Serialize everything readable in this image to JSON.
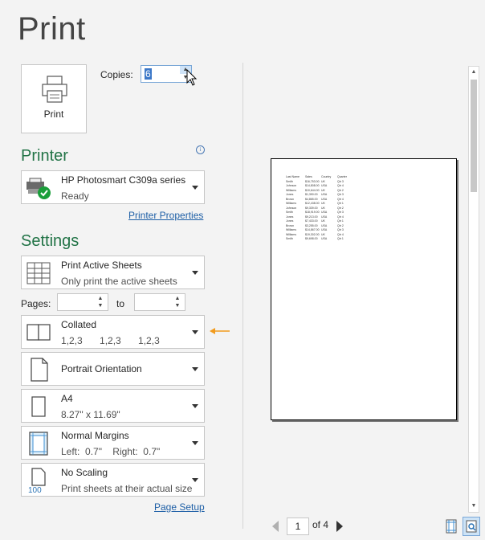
{
  "title": "Print",
  "print_button": {
    "label": "Print"
  },
  "copies": {
    "label": "Copies:",
    "value": "6"
  },
  "printer": {
    "section_title": "Printer",
    "name": "HP Photosmart C309a series",
    "status": "Ready",
    "properties_link": "Printer Properties"
  },
  "settings": {
    "section_title": "Settings",
    "sheets": {
      "title": "Print Active Sheets",
      "subtitle": "Only print the active sheets"
    },
    "pages": {
      "label": "Pages:",
      "to_label": "to",
      "from_value": "",
      "to_value": ""
    },
    "collation": {
      "title": "Collated",
      "subtitle": "1,2,3    1,2,3    1,2,3"
    },
    "orientation": {
      "title": "Portrait Orientation"
    },
    "paper": {
      "title": "A4",
      "subtitle": "8.27\" x 11.69\""
    },
    "margins": {
      "title": "Normal Margins",
      "subtitle": "Left:  0.7\"    Right:  0.7\""
    },
    "scaling": {
      "title": "No Scaling",
      "subtitle": "Print sheets at their actual size",
      "icon_text": "100"
    },
    "page_setup_link": "Page Setup"
  },
  "preview": {
    "current_page": "1",
    "of_label": "of 4",
    "sheet": {
      "headers": [
        "Last Name",
        "Sales",
        "Country",
        "Quarter"
      ],
      "rows": [
        [
          "Smith",
          "$16,753.00",
          "UK",
          "Qtr 3"
        ],
        [
          "Johnson",
          "$14,808.00",
          "USA",
          "Qtr 4"
        ],
        [
          "Williams",
          "$10,644.00",
          "UK",
          "Qtr 2"
        ],
        [
          "Jones",
          "$1,390.00",
          "USA",
          "Qtr 3"
        ],
        [
          "Brown",
          "$4,865.00",
          "USA",
          "Qtr 4"
        ],
        [
          "Williams",
          "$12,438.00",
          "UK",
          "Qtr 1"
        ],
        [
          "Johnson",
          "$9,339.00",
          "UK",
          "Qtr 2"
        ],
        [
          "Smith",
          "$18,919.00",
          "USA",
          "Qtr 3"
        ],
        [
          "Jones",
          "$9,213.00",
          "USA",
          "Qtr 4"
        ],
        [
          "Jones",
          "$7,433.00",
          "UK",
          "Qtr 1"
        ],
        [
          "Brown",
          "$3,255.00",
          "USA",
          "Qtr 2"
        ],
        [
          "Williams",
          "$14,867.00",
          "USA",
          "Qtr 3"
        ],
        [
          "Williams",
          "$19,302.00",
          "UK",
          "Qtr 4"
        ],
        [
          "Smith",
          "$9,698.00",
          "USA",
          "Qtr 1"
        ]
      ]
    }
  },
  "colors": {
    "section_heading": "#217346",
    "link": "#1e5fa6",
    "indicator_arrow": "#f29b1d"
  }
}
